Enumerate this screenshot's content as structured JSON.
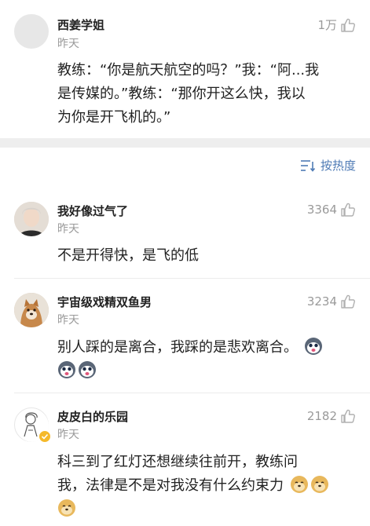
{
  "post": {
    "author": "西姜学姐",
    "time": "昨天",
    "likes": "1万",
    "content_line1": "教练：“你是航天航空的吗？”我：“阿...我",
    "content_line2": "是传媒的。”教练：“那你开这么快，我以",
    "content_line3": "为你是开飞机的。”"
  },
  "sort": {
    "label": "按热度",
    "icon": "sort-icon"
  },
  "comments": [
    {
      "author": "我好像过气了",
      "time": "昨天",
      "likes": "3364",
      "line1": "不是开得快，是飞的低"
    },
    {
      "author": "宇宙级戏精双鱼男",
      "time": "昨天",
      "likes": "3234",
      "line1": "别人踩的是离合，我踩的是悲欢离合。"
    },
    {
      "author": "皮皮白的乐园",
      "time": "昨天",
      "likes": "2182",
      "line1": "科三到了红灯还想继续往前开，教练问",
      "line2": "我，法律是不是对我没有什么约束力"
    }
  ],
  "colors": {
    "accent": "#4f7bb5",
    "muted": "#9a9a9a",
    "divider": "#eeeeee",
    "verified": "#f5b92a"
  }
}
